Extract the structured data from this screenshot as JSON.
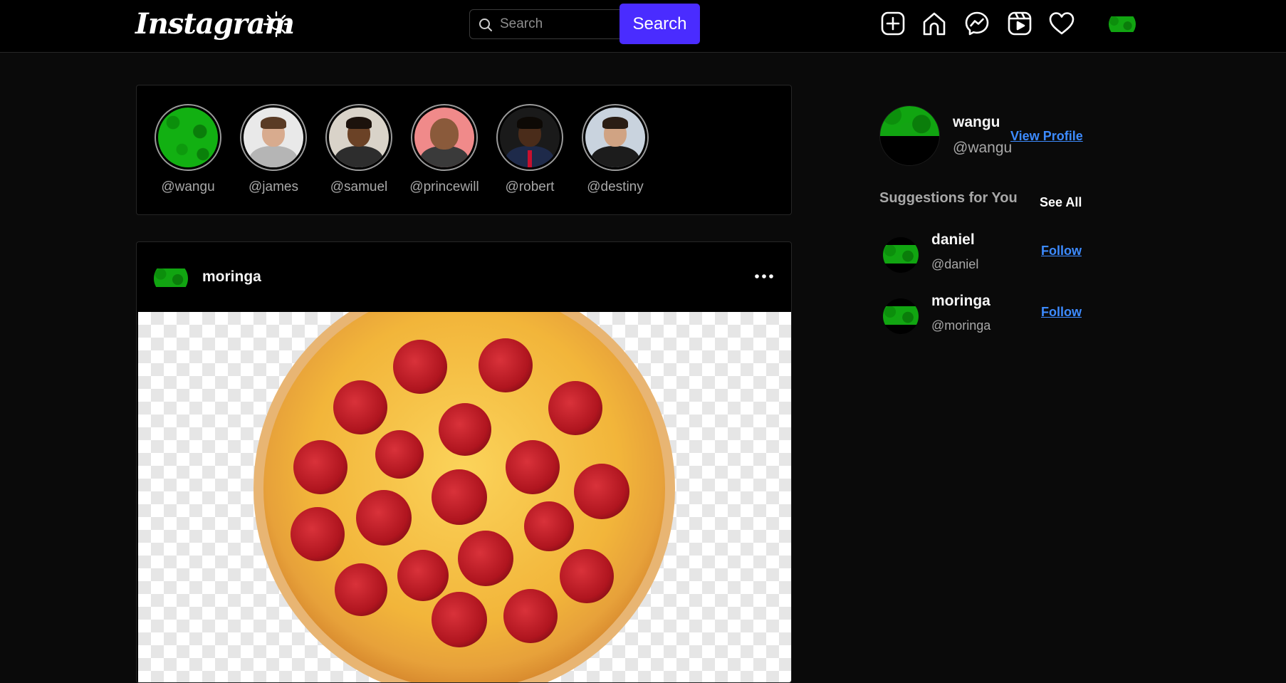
{
  "header": {
    "logo": "Instagram",
    "theme_icon": "sun-icon",
    "search_placeholder": "Search",
    "search_button": "Search",
    "icons": [
      "plus-square-icon",
      "home-icon",
      "messenger-icon",
      "reels-icon",
      "heart-icon"
    ]
  },
  "stories": [
    {
      "handle": "@wangu",
      "avatar": "green-grass"
    },
    {
      "handle": "@james",
      "avatar": "man-grey-shirt"
    },
    {
      "handle": "@samuel",
      "avatar": "smiling-man"
    },
    {
      "handle": "@princewill",
      "avatar": "man-glasses"
    },
    {
      "handle": "@robert",
      "avatar": "man-suit-red-tie"
    },
    {
      "handle": "@destiny",
      "avatar": "man-suit"
    }
  ],
  "post": {
    "username": "moringa",
    "image": "pepperoni-pizza",
    "more_icon": "more-horizontal-icon"
  },
  "profile": {
    "name": "wangu",
    "handle": "@wangu",
    "view_profile": "View Profile"
  },
  "suggestions": {
    "title": "Suggestions for You",
    "see_all": "See All",
    "items": [
      {
        "name": "daniel",
        "handle": "@daniel",
        "action": "Follow"
      },
      {
        "name": "moringa",
        "handle": "@moringa",
        "action": "Follow"
      }
    ]
  },
  "colors": {
    "background": "#0a0a0a",
    "surface": "#000000",
    "accent_button": "#4a2cff",
    "link": "#3d8bff",
    "grass": "#11a511"
  }
}
